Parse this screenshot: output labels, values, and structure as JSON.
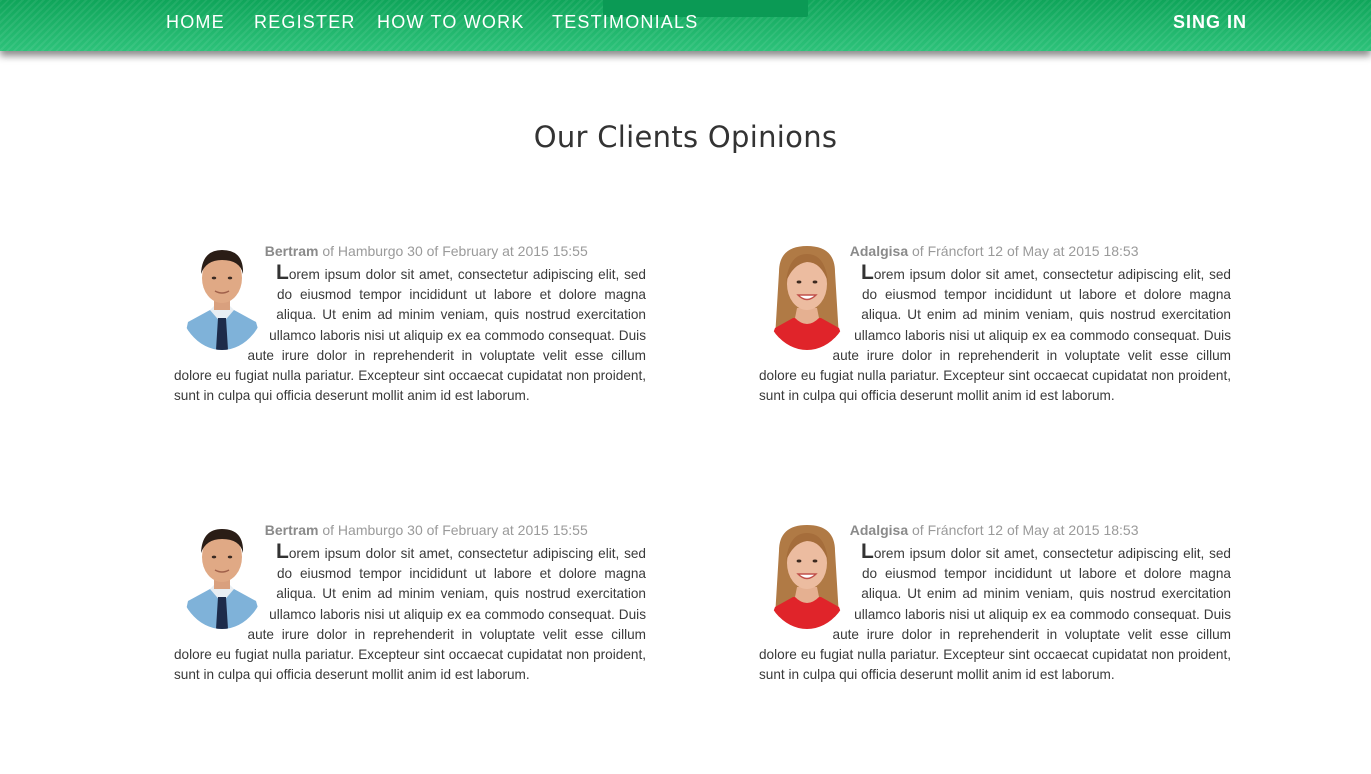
{
  "nav": {
    "home": "HOME",
    "register": "REGISTER",
    "how_to_work": "HOW TO WORK",
    "testimonials": "TESTIMONIALS",
    "sign_in": "SING IN"
  },
  "page": {
    "title": "Our Clients Opinions"
  },
  "colors": {
    "nav_green": "#1db46a",
    "text": "#333333",
    "meta": "#9a9a9a"
  },
  "testimonials": [
    {
      "author": "Bertram",
      "meta": " of Hamburgo 30 of February at 2015 15:55",
      "dropcap": "L",
      "text": "orem ipsum dolor sit amet, consectetur adipiscing elit, sed do eiusmod tempor incididunt ut labore et dolore magna aliqua. Ut enim ad minim veniam, quis nostrud exercitation ullamco laboris nisi ut aliquip ex ea commodo consequat. Duis aute irure dolor in reprehenderit in voluptate velit esse cillum dolore eu fugiat nulla pariatur. Excepteur sint occaecat cupidatat non proident, sunt in culpa qui officia deserunt mollit anim id est laborum."
    },
    {
      "author": "Adalgisa",
      "meta": " of Fráncfort 12 of May at 2015 18:53",
      "dropcap": "L",
      "text": "orem ipsum dolor sit amet, consectetur adipiscing elit, sed do eiusmod tempor incididunt ut labore et dolore magna aliqua. Ut enim ad minim veniam, quis nostrud exercitation ullamco laboris nisi ut aliquip ex ea commodo consequat. Duis aute irure dolor in reprehenderit in voluptate velit esse cillum dolore eu fugiat nulla pariatur. Excepteur sint occaecat cupidatat non proident, sunt in culpa qui officia deserunt mollit anim id est laborum."
    },
    {
      "author": "Bertram",
      "meta": " of Hamburgo 30 of February at 2015 15:55",
      "dropcap": "L",
      "text": "orem ipsum dolor sit amet, consectetur adipiscing elit, sed do eiusmod tempor incididunt ut labore et dolore magna aliqua. Ut enim ad minim veniam, quis nostrud exercitation ullamco laboris nisi ut aliquip ex ea commodo consequat. Duis aute irure dolor in reprehenderit in voluptate velit esse cillum dolore eu fugiat nulla pariatur. Excepteur sint occaecat cupidatat non proident, sunt in culpa qui officia deserunt mollit anim id est laborum."
    },
    {
      "author": "Adalgisa",
      "meta": " of Fráncfort 12 of May at 2015 18:53",
      "dropcap": "L",
      "text": "orem ipsum dolor sit amet, consectetur adipiscing elit, sed do eiusmod tempor incididunt ut labore et dolore magna aliqua. Ut enim ad minim veniam, quis nostrud exercitation ullamco laboris nisi ut aliquip ex ea commodo consequat. Duis aute irure dolor in reprehenderit in voluptate velit esse cillum dolore eu fugiat nulla pariatur. Excepteur sint occaecat cupidatat non proident, sunt in culpa qui officia deserunt mollit anim id est laborum."
    }
  ]
}
